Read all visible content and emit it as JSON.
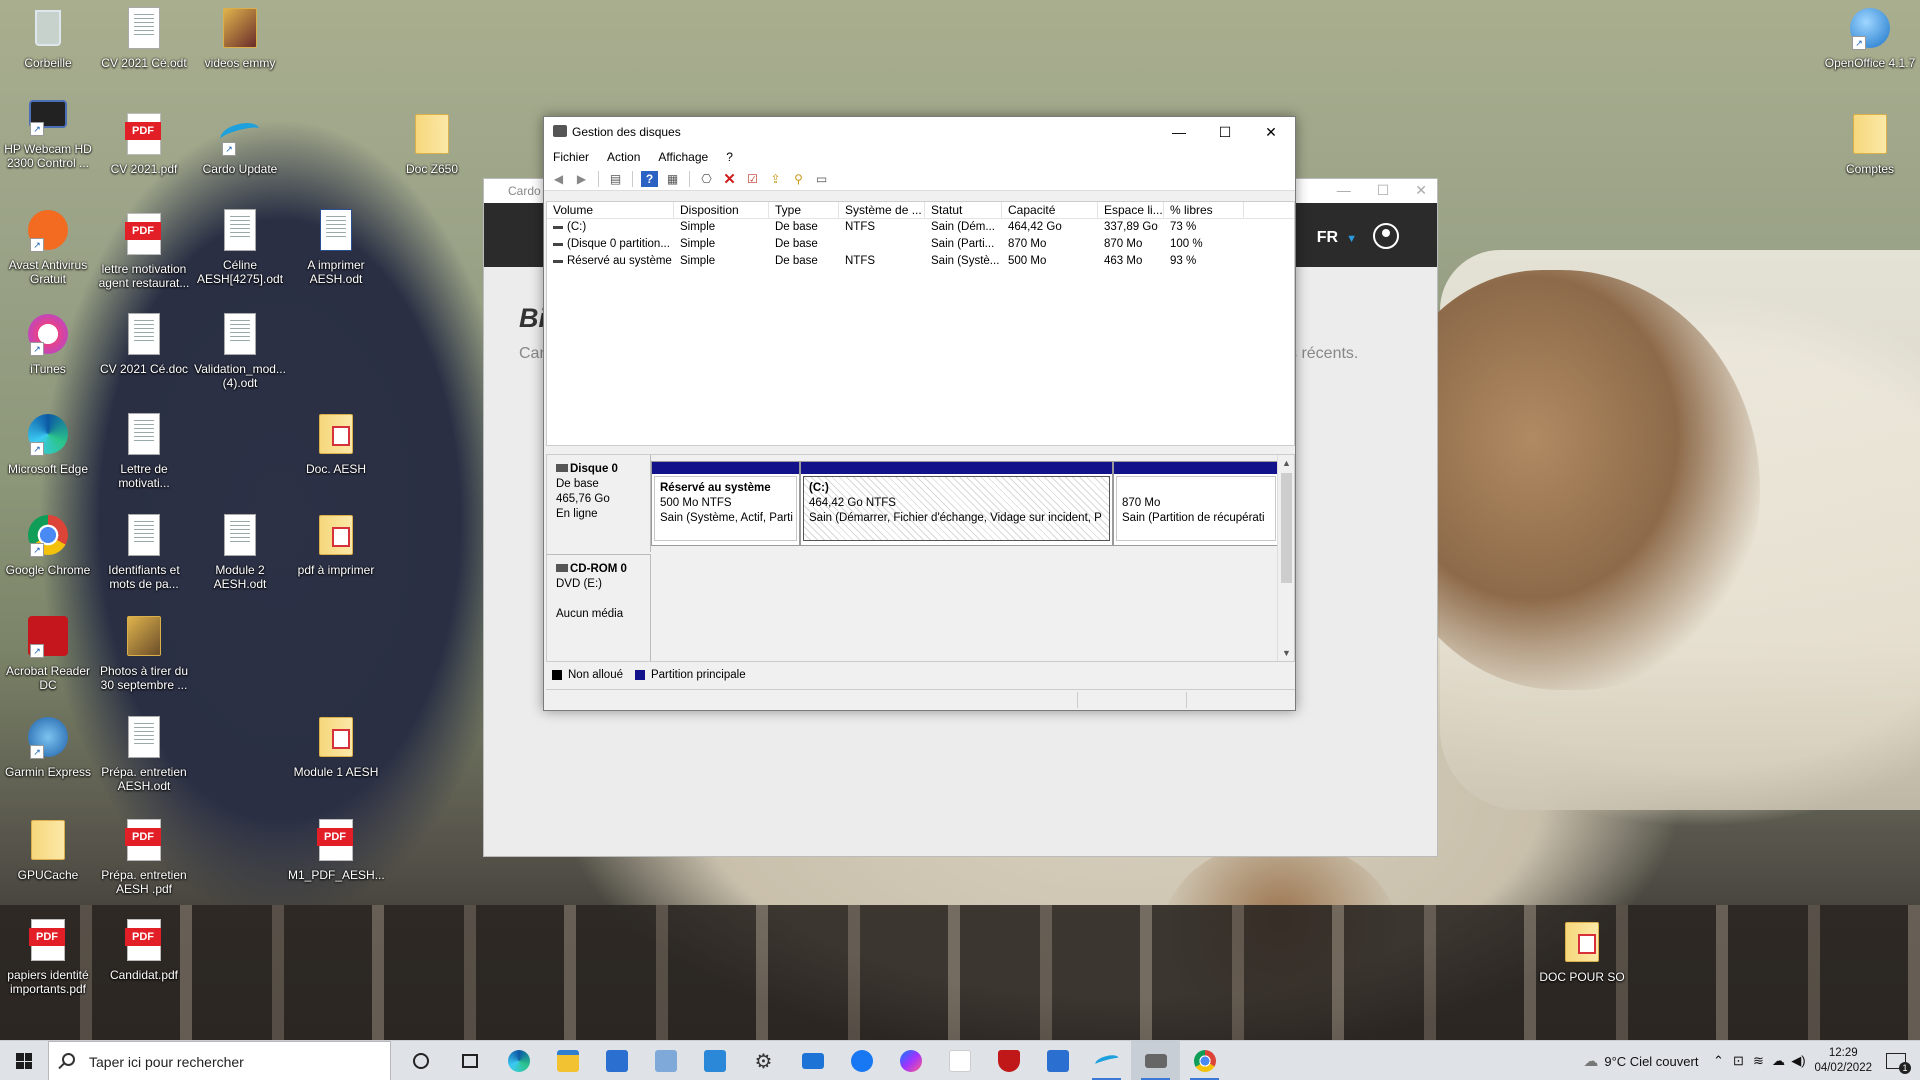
{
  "desktop": {
    "icons": [
      {
        "label": "Corbeille"
      },
      {
        "label": "CV 2021 Cé.odt"
      },
      {
        "label": "videos emmy"
      },
      {
        "label": "HP Webcam HD 2300 Control ..."
      },
      {
        "label": "CV 2021.pdf"
      },
      {
        "label": "Cardo Update"
      },
      {
        "label": "Doc Z650"
      },
      {
        "label": "Avast Antivirus Gratuit"
      },
      {
        "label": "lettre motivation agent restaurat..."
      },
      {
        "label": "Céline AESH[4275].odt"
      },
      {
        "label": "A imprimer AESH.odt"
      },
      {
        "label": "iTunes"
      },
      {
        "label": "CV 2021 Cé.doc"
      },
      {
        "label": "Validation_mod... (4).odt"
      },
      {
        "label": "Microsoft Edge"
      },
      {
        "label": "Lettre de motivati..."
      },
      {
        "label": "Doc. AESH"
      },
      {
        "label": "Google Chrome"
      },
      {
        "label": "Identifiants et mots de pa..."
      },
      {
        "label": "Module 2 AESH.odt"
      },
      {
        "label": "pdf à imprimer"
      },
      {
        "label": "Acrobat Reader DC"
      },
      {
        "label": "Photos à tirer du 30 septembre ..."
      },
      {
        "label": "Garmin Express"
      },
      {
        "label": "Prépa. entretien AESH.odt"
      },
      {
        "label": "Module 1 AESH"
      },
      {
        "label": "GPUCache"
      },
      {
        "label": "Prépa. entretien AESH .pdf"
      },
      {
        "label": "M1_PDF_AESH..."
      },
      {
        "label": "papiers identité importants.pdf"
      },
      {
        "label": "Candidat.pdf"
      },
      {
        "label": "OpenOffice 4.1.7"
      },
      {
        "label": "Comptes"
      },
      {
        "label": "DOC POUR SO"
      }
    ]
  },
  "cardo": {
    "title": "Cardo",
    "lang": "FR",
    "heading": "Bi",
    "subtext": "Car",
    "recents": "s récents."
  },
  "diskmgmt": {
    "title": "Gestion des disques",
    "menu": [
      "Fichier",
      "Action",
      "Affichage",
      "?"
    ],
    "columns": [
      "Volume",
      "Disposition",
      "Type",
      "Système de ...",
      "Statut",
      "Capacité",
      "Espace li...",
      "% libres"
    ],
    "rows": [
      [
        "(C:)",
        "Simple",
        "De base",
        "NTFS",
        "Sain (Dém...",
        "464,42 Go",
        "337,89 Go",
        "73 %"
      ],
      [
        "(Disque 0 partition...",
        "Simple",
        "De base",
        "",
        "Sain (Parti...",
        "870 Mo",
        "870 Mo",
        "100 %"
      ],
      [
        "Réservé au système",
        "Simple",
        "De base",
        "NTFS",
        "Sain (Systè...",
        "500 Mo",
        "463 Mo",
        "93 %"
      ]
    ],
    "disk0": {
      "name": "Disque 0",
      "kind": "De base",
      "size": "465,76 Go",
      "state": "En ligne",
      "partitions": [
        {
          "name": "Réservé au système",
          "size": "500 Mo NTFS",
          "status": "Sain (Système, Actif, Parti"
        },
        {
          "name": "(C:)",
          "size": "464,42 Go NTFS",
          "status": "Sain (Démarrer, Fichier d'échange, Vidage sur incident, P"
        },
        {
          "name": "",
          "size": "870 Mo",
          "status": "Sain (Partition de récupérati"
        }
      ]
    },
    "cdrom": {
      "name": "CD-ROM 0",
      "drive": "DVD (E:)",
      "media": "Aucun média"
    },
    "legend": {
      "unallocated": "Non alloué",
      "primary": "Partition principale",
      "unallocated_color": "#000000",
      "primary_color": "#12128a"
    }
  },
  "taskbar": {
    "search_placeholder": "Taper ici pour rechercher",
    "weather": "9°C  Ciel couvert",
    "time": "12:29",
    "date": "04/02/2022",
    "notification_count": "1",
    "accent": "#3b78d8"
  }
}
